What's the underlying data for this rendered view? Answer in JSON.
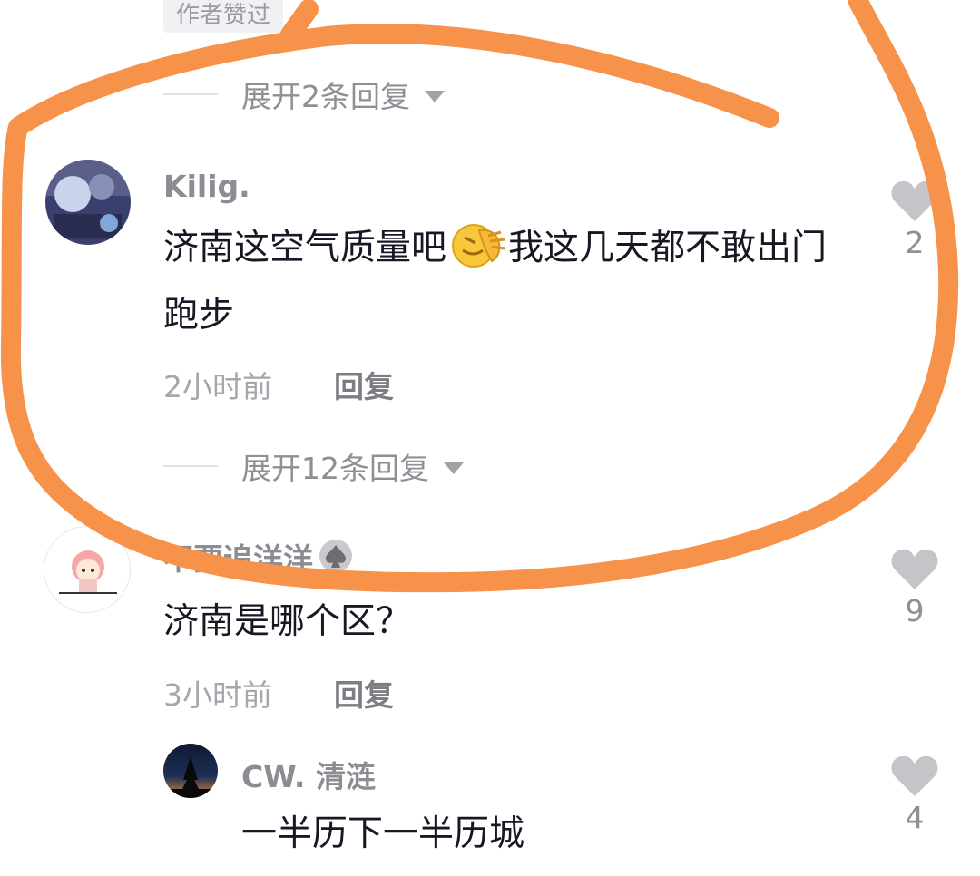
{
  "top_badge": "作者赞过",
  "expand_replies_1": "展开2条回复",
  "comments": [
    {
      "username": "Kilig.",
      "text_before_emoji": "济南这空气质量吧",
      "emoji": "facepalm-emoji",
      "text_after_emoji": "我这几天都不敢出门跑步",
      "time": "2小时前",
      "reply_label": "回复",
      "likes": "2",
      "expand_label": "展开12条回复"
    },
    {
      "username": "不要追洋洋",
      "username_badge": "spade-icon",
      "text": "济南是哪个区？",
      "time": "3小时前",
      "reply_label": "回复",
      "likes": "9"
    }
  ],
  "reply": {
    "username": "CW. 清涟",
    "text": "一半历下一半历城",
    "likes": "4"
  },
  "annotation_color": "#f7924a"
}
